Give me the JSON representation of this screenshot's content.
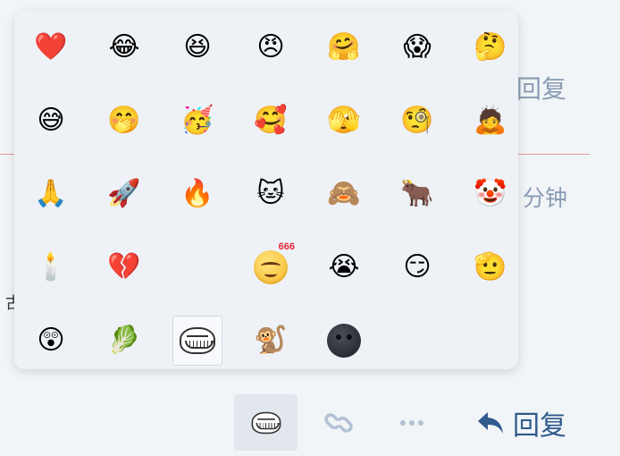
{
  "background": {
    "reply_label": "回复",
    "minute_label": "分钟",
    "cut_char": "古"
  },
  "picker": {
    "selected_index": 30,
    "emojis": [
      {
        "glyph": "❤️",
        "name": "red-heart-icon"
      },
      {
        "glyph": "😂",
        "name": "tears-of-joy-icon"
      },
      {
        "glyph": "😆",
        "name": "grinning-squinting-icon"
      },
      {
        "glyph": "😠",
        "name": "angry-face-icon"
      },
      {
        "glyph": "🤗",
        "name": "hugging-face-icon"
      },
      {
        "glyph": "😱",
        "name": "screaming-face-icon"
      },
      {
        "glyph": "🤔",
        "name": "thinking-face-icon"
      },
      {
        "glyph": "😅",
        "name": "sweat-smile-icon"
      },
      {
        "glyph": "🤭",
        "name": "laughing-cover-mouth-icon"
      },
      {
        "glyph": "🥳",
        "name": "party-face-icon"
      },
      {
        "glyph": "🥰",
        "name": "smiling-hearts-icon"
      },
      {
        "glyph": "🫣",
        "name": "peeking-face-icon"
      },
      {
        "glyph": "🧐",
        "name": "monocle-face-icon"
      },
      {
        "glyph": "🙇",
        "name": "person-bowing-icon"
      },
      {
        "glyph": "🙏",
        "name": "folded-hands-icon"
      },
      {
        "glyph": "🚀",
        "name": "rocket-icon"
      },
      {
        "glyph": "🔥",
        "name": "fire-icon"
      },
      {
        "glyph": "🐱",
        "name": "doge-cat-icon"
      },
      {
        "glyph": "🙈",
        "name": "see-no-evil-monkey-icon"
      },
      {
        "glyph": "🐂",
        "name": "ox-icon"
      },
      {
        "glyph": "🤡",
        "name": "clown-face-icon"
      },
      {
        "glyph": "🕯️",
        "name": "candle-icon"
      },
      {
        "glyph": "💔",
        "name": "broken-heart-icon"
      },
      {
        "glyph": "",
        "name": "empty-slot"
      },
      {
        "glyph": "666",
        "name": "smirk-666-icon",
        "custom": "face666"
      },
      {
        "glyph": "😭",
        "name": "crying-face-icon"
      },
      {
        "glyph": "😏",
        "name": "smirking-face-icon"
      },
      {
        "glyph": "🫡",
        "name": "saluting-face-icon"
      },
      {
        "glyph": "😲",
        "name": "astonished-face-icon"
      },
      {
        "glyph": "🥬",
        "name": "leafy-green-icon"
      },
      {
        "glyph": "",
        "name": "troll-face-icon",
        "custom": "troll"
      },
      {
        "glyph": "🐒",
        "name": "monkey-icon"
      },
      {
        "glyph": "",
        "name": "new-moon-face-icon",
        "custom": "moon"
      }
    ]
  },
  "toolbar": {
    "emoji_button_icon": "troll-face-icon",
    "link_button_icon": "link-icon",
    "more_button_icon": "more-dots-icon",
    "reply_label": "回复",
    "reply_icon": "reply-arrow-icon",
    "accent_color": "#2f5a8c"
  }
}
